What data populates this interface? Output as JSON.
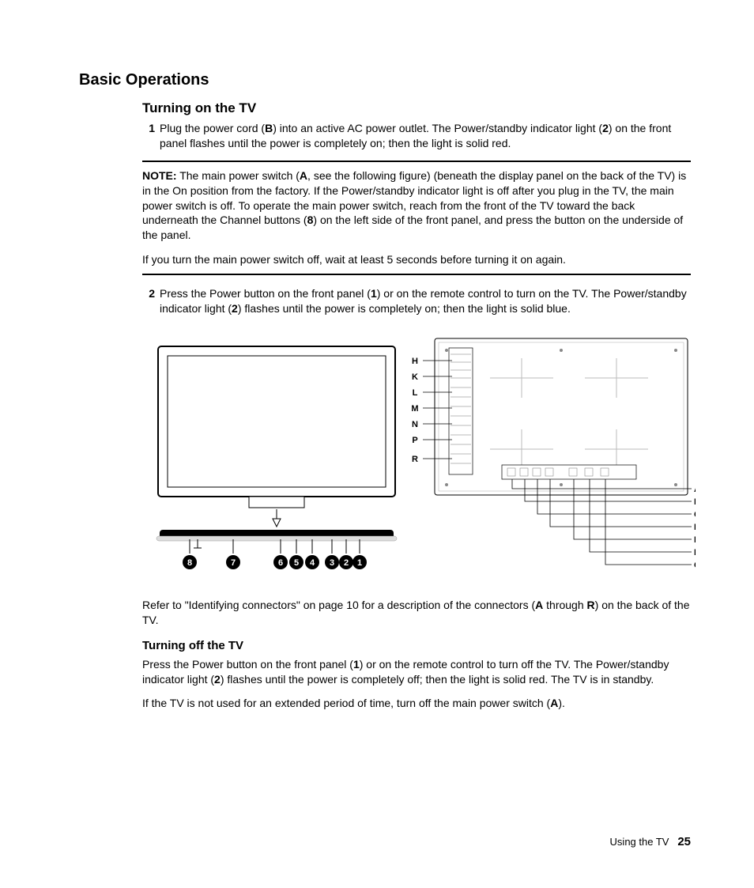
{
  "h1": "Basic Operations",
  "h2": "Turning on the TV",
  "step1": {
    "num": "1",
    "text_a": "Plug the power cord (",
    "b": "B",
    "text_b": ") into an active AC power outlet. The Power/standby indicator light (",
    "two": "2",
    "text_c": ") on the front panel flashes until the power is completely on; then the light is solid red."
  },
  "note": {
    "label": "NOTE:",
    "text_a": " The main power switch (",
    "a": "A",
    "text_b": ", see the following figure) (beneath the display panel on the back of the TV) is in the On position from the factory. If the Power/standby indicator light is off after you plug in the TV, the main power switch is off. To operate the main power switch, reach from the front of the TV toward the back underneath the Channel buttons (",
    "eight": "8",
    "text_c": ") on the left side of the front panel, and press the button on the underside of the panel.",
    "para2": "If you turn the main power switch off, wait at least 5 seconds before turning it on again."
  },
  "step2": {
    "num": "2",
    "text_a": "Press the Power button on the front panel (",
    "one": "1",
    "text_b": ") or on the remote control to turn on the TV. The Power/standby indicator light (",
    "two": "2",
    "text_c": ") flashes until the power is completely on; then the light is solid blue."
  },
  "diagram": {
    "left_labels": [
      "H",
      "K",
      "L",
      "M",
      "N",
      "P",
      "R"
    ],
    "right_labels": [
      "A",
      "B",
      "C",
      "D",
      "E",
      "F",
      "G"
    ],
    "numbers": [
      "8",
      "7",
      "6",
      "5",
      "4",
      "3",
      "2",
      "1"
    ]
  },
  "refer": {
    "text_a": "Refer to \"Identifying connectors\" on page 10 for a description of the connectors (",
    "a": "A",
    "text_b": " through ",
    "r": "R",
    "text_c": ") on the back of the TV."
  },
  "h3": "Turning off the TV",
  "off_p1": {
    "text_a": "Press the Power button on the front panel (",
    "one": "1",
    "text_b": ") or on the remote control to turn off the TV. The Power/standby indicator light (",
    "two": "2",
    "text_c": ") flashes until the power is completely off; then the light is solid red. The TV is in standby."
  },
  "off_p2": {
    "text_a": "If the TV is not used for an extended period of time, turn off the main power switch (",
    "a": "A",
    "text_b": ")."
  },
  "footer": {
    "section": "Using the TV",
    "page": "25"
  }
}
